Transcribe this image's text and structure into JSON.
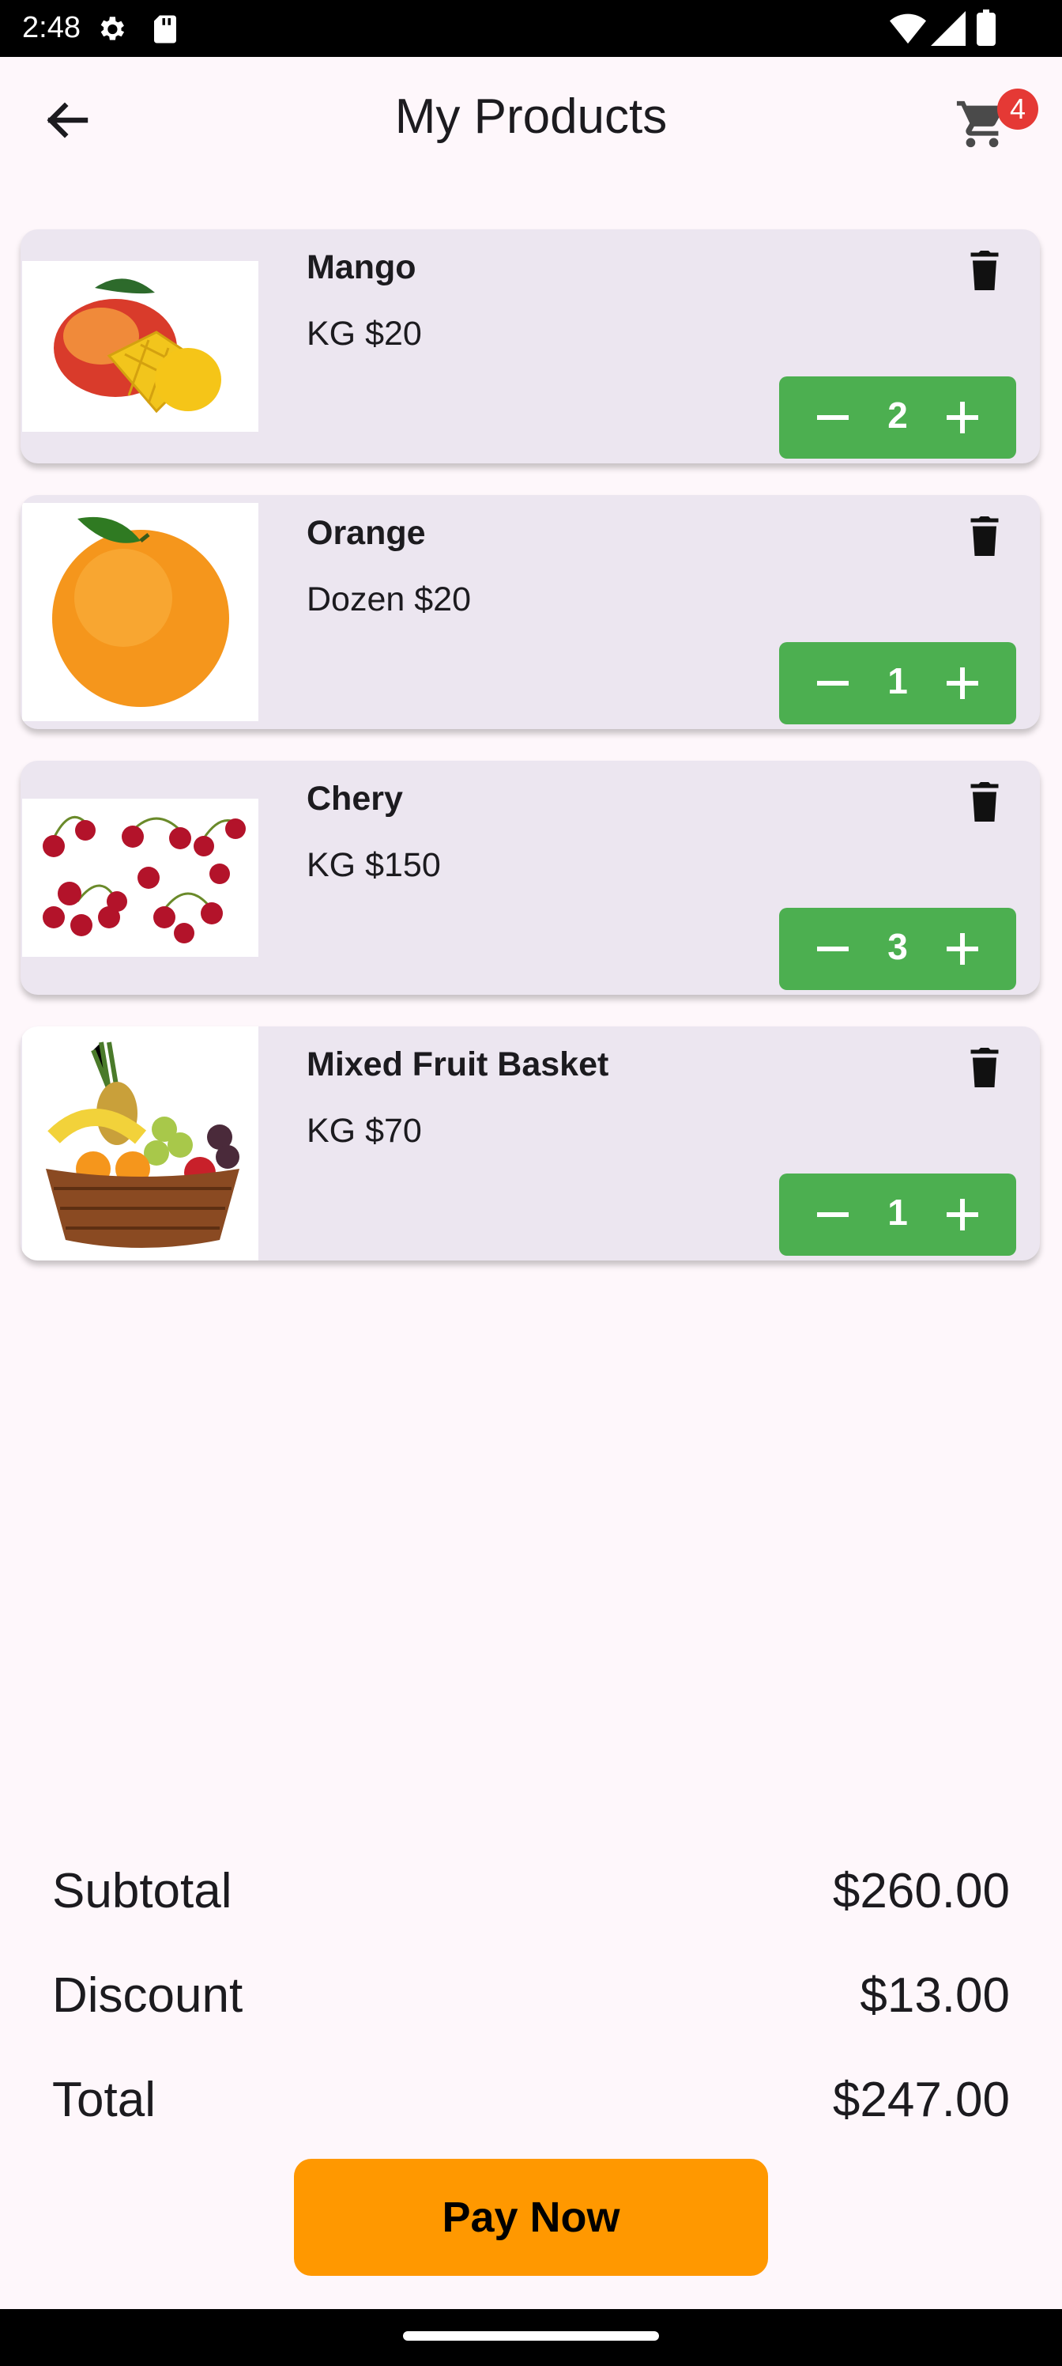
{
  "status_bar": {
    "time": "2:48"
  },
  "app_bar": {
    "title": "My Products",
    "cart_badge": "4"
  },
  "products": [
    {
      "name": "Mango",
      "price": "KG $20",
      "qty": "2",
      "image": "mango-image"
    },
    {
      "name": "Orange",
      "price": "Dozen $20",
      "qty": "1",
      "image": "orange-image"
    },
    {
      "name": "Chery",
      "price": "KG $150",
      "qty": "3",
      "image": "cherry-image"
    },
    {
      "name": "Mixed Fruit Basket",
      "price": "KG $70",
      "qty": "1",
      "image": "fruit-basket-image"
    }
  ],
  "summary": {
    "subtotal_label": "Subtotal",
    "subtotal_value": "$260.00",
    "discount_label": "Discount",
    "discount_value": "$13.00",
    "total_label": "Total",
    "total_value": "$247.00"
  },
  "pay_button": "Pay Now",
  "colors": {
    "accent_green": "#4caf50",
    "pay_orange": "#ff9800",
    "badge_red": "#e53935"
  }
}
